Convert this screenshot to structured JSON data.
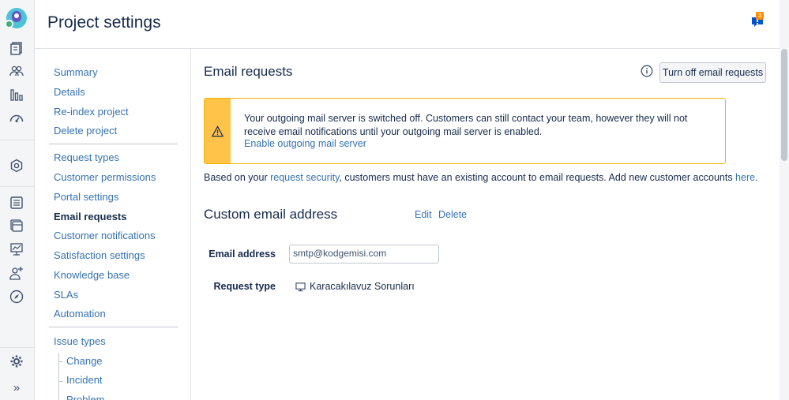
{
  "page": {
    "title": "Project settings"
  },
  "notification": {
    "count": "3"
  },
  "sidebar": {
    "items": [
      {
        "label": "Summary"
      },
      {
        "label": "Details"
      },
      {
        "label": "Re-index project"
      },
      {
        "label": "Delete project"
      },
      {
        "label": "Request types"
      },
      {
        "label": "Customer permissions"
      },
      {
        "label": "Portal settings"
      },
      {
        "label": "Email requests"
      },
      {
        "label": "Customer notifications"
      },
      {
        "label": "Satisfaction settings"
      },
      {
        "label": "Knowledge base"
      },
      {
        "label": "SLAs"
      },
      {
        "label": "Automation"
      },
      {
        "label": "Issue types"
      },
      {
        "label": "Change"
      },
      {
        "label": "Incident"
      },
      {
        "label": "Problem"
      }
    ]
  },
  "main": {
    "section_title": "Email requests",
    "toggle_button": "Turn off email requests",
    "warning": {
      "text": "Your outgoing mail server is switched off. Customers can still contact your team, however they will not receive email notifications until your outgoing mail server is enabled.",
      "link": "Enable outgoing mail server"
    },
    "note": {
      "before": "Based on your ",
      "link1": "request security",
      "middle": ", customers must have an existing account to email requests. Add new customer accounts ",
      "link2": "here",
      "after": "."
    },
    "custom_email": {
      "title": "Custom email address",
      "edit": "Edit",
      "delete": "Delete",
      "email_label": "Email address",
      "email_value": "smtp@kodgemisi.com",
      "request_type_label": "Request type",
      "request_type_value": "Karacakılavuz Sorunları"
    }
  },
  "colors": {
    "link": "#3572b0",
    "warning": "#ffc34a",
    "badge": "#ff8b00"
  }
}
